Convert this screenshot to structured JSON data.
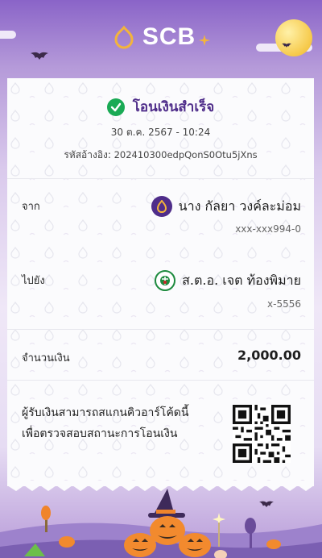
{
  "brand": {
    "name": "SCB"
  },
  "receipt": {
    "status": "โอนเงินสำเร็จ",
    "datetime": "30 ต.ค. 2567 - 10:24",
    "reference_label": "รหัสอ้างอิง:",
    "reference_code": "202410300edpQonS0Otu5jXns",
    "from": {
      "label": "จาก",
      "name": "นาง กัลยา วงค์ละม่อม",
      "account": "xxx-xxx994-0"
    },
    "to": {
      "label": "ไปยัง",
      "name": "ส.ต.อ. เจต ท้องพิมาย",
      "account": "x-5556"
    },
    "amount_label": "จำนวนเงิน",
    "amount": "2,000.00",
    "qr_note_line1": "ผู้รับเงินสามารถสแกนคิวอาร์โค้ดนี้",
    "qr_note_line2": "เพื่อตรวจสอบสถานะการโอนเงิน"
  },
  "colors": {
    "brand_purple": "#4f2d8a",
    "success_green": "#1aaa55",
    "background_top": "#8a64c8"
  },
  "icons": [
    "scb-logo-icon",
    "sparkle-icon",
    "moon-icon",
    "bat-icon",
    "check-circle-icon",
    "bank-avatar-icon",
    "kasikorn-avatar-icon",
    "qr-code",
    "pumpkin-icon"
  ]
}
